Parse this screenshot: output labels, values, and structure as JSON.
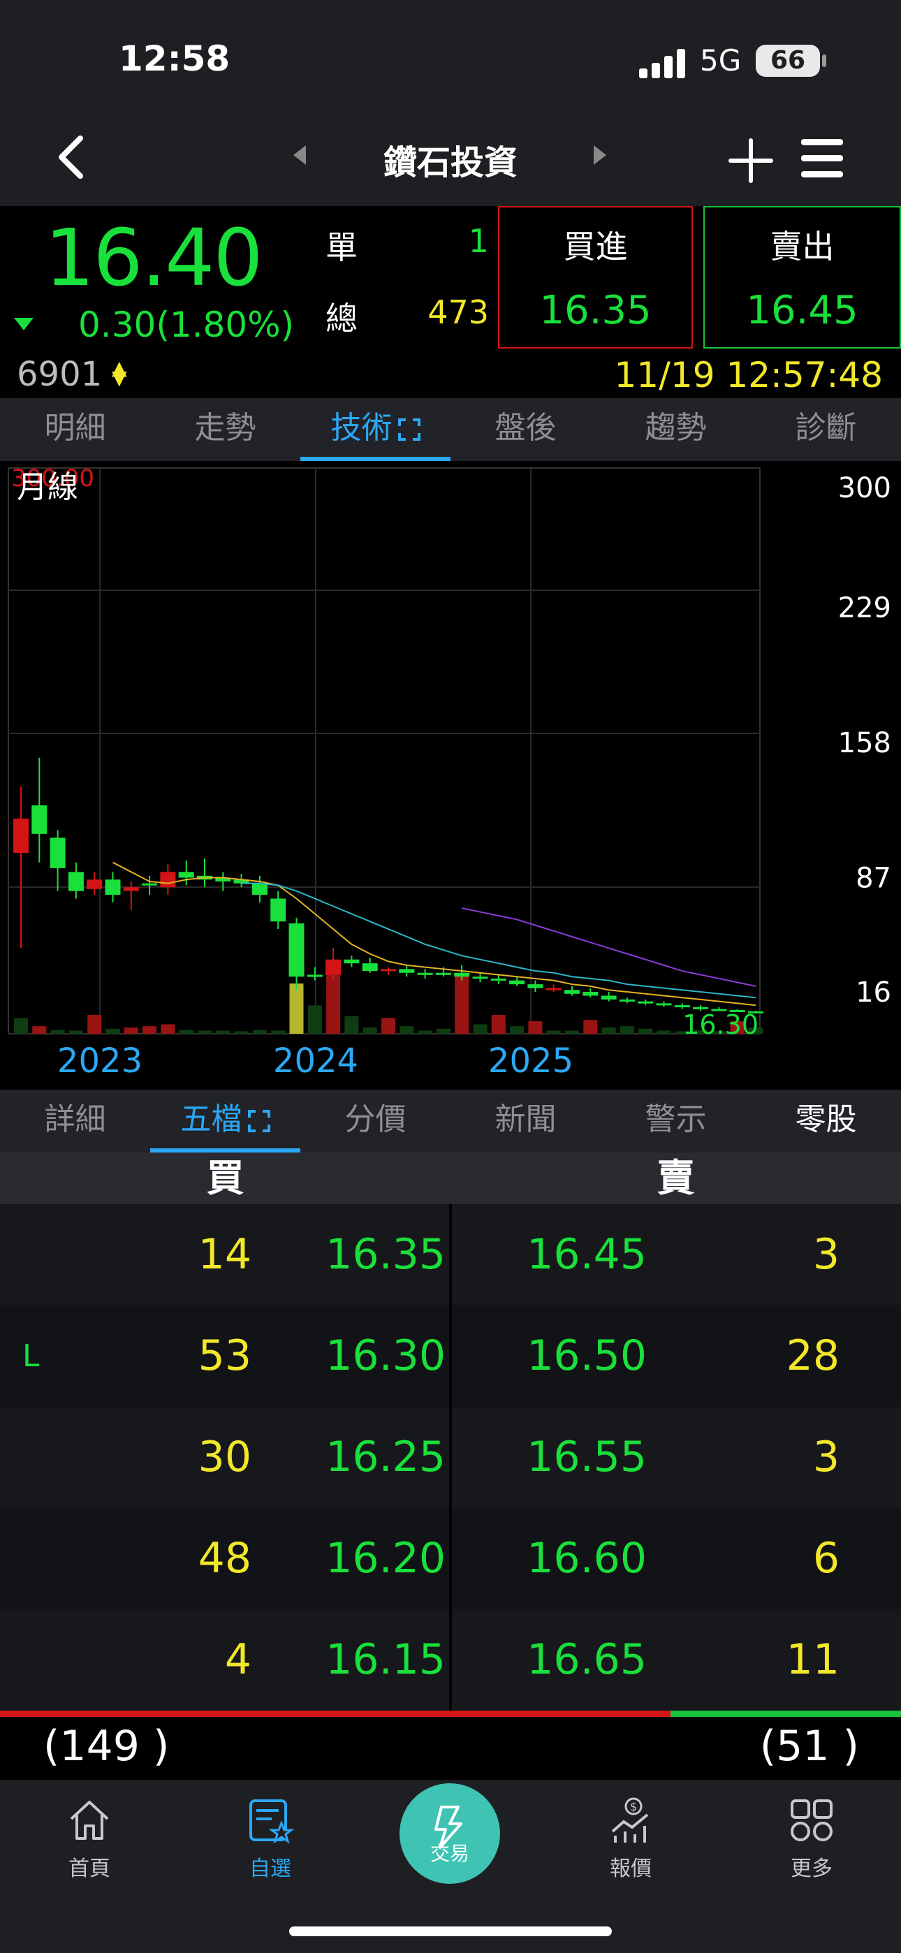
{
  "status": {
    "time": "12:58",
    "network": "5G",
    "battery": "66"
  },
  "nav": {
    "title": "鑽石投資"
  },
  "quote": {
    "price": "16.40",
    "change": "0.30(1.80%)",
    "single_label": "單",
    "single_value": "1",
    "total_label": "總",
    "total_value": "473",
    "buy_label": "買進",
    "buy_value": "16.35",
    "sell_label": "賣出",
    "sell_value": "16.45",
    "code": "6901",
    "datetime": "11/19 12:57:48"
  },
  "tabs_top": [
    {
      "label": "明細"
    },
    {
      "label": "走勢"
    },
    {
      "label": "技術"
    },
    {
      "label": "盤後"
    },
    {
      "label": "趨勢"
    },
    {
      "label": "診斷"
    }
  ],
  "chart": {
    "period_label": "月線",
    "max_label": "300.00",
    "y_ticks": [
      "300",
      "229",
      "158",
      "87",
      "16"
    ],
    "x_ticks": [
      "2023",
      "2024",
      "2025"
    ],
    "last_label": "16.30"
  },
  "chart_data": {
    "type": "candlestick",
    "ylim": [
      16,
      300
    ],
    "y_ticks": [
      300,
      229,
      158,
      87,
      16
    ],
    "x_ticks": [
      "2023",
      "2024",
      "2025"
    ],
    "candles": [
      {
        "o": 100,
        "c": 118,
        "h": 135,
        "l": 50,
        "up": true
      },
      {
        "o": 125,
        "c": 110,
        "h": 150,
        "l": 95,
        "up": false
      },
      {
        "o": 108,
        "c": 92,
        "h": 112,
        "l": 80,
        "up": false
      },
      {
        "o": 90,
        "c": 80,
        "h": 95,
        "l": 76,
        "up": false
      },
      {
        "o": 81,
        "c": 86,
        "h": 90,
        "l": 78,
        "up": true
      },
      {
        "o": 86,
        "c": 78,
        "h": 90,
        "l": 74,
        "up": false
      },
      {
        "o": 80,
        "c": 82,
        "h": 85,
        "l": 70,
        "up": true
      },
      {
        "o": 83,
        "c": 84,
        "h": 88,
        "l": 78,
        "up": false
      },
      {
        "o": 82,
        "c": 90,
        "h": 94,
        "l": 78,
        "up": true
      },
      {
        "o": 90,
        "c": 87,
        "h": 96,
        "l": 83,
        "up": false
      },
      {
        "o": 88,
        "c": 86,
        "h": 97,
        "l": 82,
        "up": false
      },
      {
        "o": 87,
        "c": 85,
        "h": 90,
        "l": 80,
        "up": false
      },
      {
        "o": 86,
        "c": 84,
        "h": 89,
        "l": 82,
        "up": false
      },
      {
        "o": 84,
        "c": 78,
        "h": 88,
        "l": 74,
        "up": false
      },
      {
        "o": 76,
        "c": 64,
        "h": 80,
        "l": 60,
        "up": false
      },
      {
        "o": 63,
        "c": 35,
        "h": 66,
        "l": 28,
        "up": false
      },
      {
        "o": 35,
        "c": 36,
        "h": 40,
        "l": 33,
        "up": false
      },
      {
        "o": 36,
        "c": 44,
        "h": 50,
        "l": 33,
        "up": true
      },
      {
        "o": 44,
        "c": 42,
        "h": 46,
        "l": 40,
        "up": false
      },
      {
        "o": 42,
        "c": 38,
        "h": 45,
        "l": 37,
        "up": false
      },
      {
        "o": 38,
        "c": 39,
        "h": 40,
        "l": 36,
        "up": true
      },
      {
        "o": 39,
        "c": 37,
        "h": 41,
        "l": 35,
        "up": false
      },
      {
        "o": 37,
        "c": 36,
        "h": 39,
        "l": 34,
        "up": false
      },
      {
        "o": 36,
        "c": 37,
        "h": 40,
        "l": 35,
        "up": false
      },
      {
        "o": 37,
        "c": 35,
        "h": 41,
        "l": 33,
        "up": false
      },
      {
        "o": 35,
        "c": 34,
        "h": 37,
        "l": 32,
        "up": false
      },
      {
        "o": 34,
        "c": 33,
        "h": 36,
        "l": 31,
        "up": false
      },
      {
        "o": 33,
        "c": 31,
        "h": 35,
        "l": 30,
        "up": false
      },
      {
        "o": 31,
        "c": 29,
        "h": 33,
        "l": 27,
        "up": false
      },
      {
        "o": 29,
        "c": 28,
        "h": 31,
        "l": 27,
        "up": true
      },
      {
        "o": 28,
        "c": 26,
        "h": 30,
        "l": 25,
        "up": false
      },
      {
        "o": 27,
        "c": 25,
        "h": 29,
        "l": 24,
        "up": false
      },
      {
        "o": 25,
        "c": 23,
        "h": 27,
        "l": 22,
        "up": false
      },
      {
        "o": 23,
        "c": 22,
        "h": 24,
        "l": 21,
        "up": false
      },
      {
        "o": 22,
        "c": 21,
        "h": 23,
        "l": 20,
        "up": false
      },
      {
        "o": 21,
        "c": 20,
        "h": 22,
        "l": 19,
        "up": false
      },
      {
        "o": 20,
        "c": 19,
        "h": 21,
        "l": 18,
        "up": false
      },
      {
        "o": 19,
        "c": 18,
        "h": 20,
        "l": 17,
        "up": false
      },
      {
        "o": 18,
        "c": 17.5,
        "h": 19,
        "l": 17,
        "up": false
      },
      {
        "o": 17.5,
        "c": 16.8,
        "h": 18,
        "l": 16.5,
        "up": false
      },
      {
        "o": 16.8,
        "c": 16.3,
        "h": 17.2,
        "l": 16.2,
        "up": false
      }
    ],
    "volume": [
      0.25,
      0.12,
      0.06,
      0.05,
      0.3,
      0.08,
      0.1,
      0.12,
      0.15,
      0.06,
      0.05,
      0.05,
      0.04,
      0.06,
      0.05,
      0.8,
      0.45,
      1.0,
      0.28,
      0.1,
      0.25,
      0.12,
      0.05,
      0.08,
      0.93,
      0.15,
      0.3,
      0.12,
      0.2,
      0.05,
      0.05,
      0.22,
      0.1,
      0.12,
      0.08,
      0.05,
      0.04,
      0.06,
      0.04,
      0.2,
      0.1
    ],
    "volume_up": [
      false,
      true,
      false,
      false,
      true,
      false,
      true,
      true,
      true,
      false,
      false,
      false,
      false,
      false,
      false,
      false,
      false,
      true,
      false,
      false,
      true,
      false,
      false,
      false,
      true,
      false,
      true,
      false,
      true,
      false,
      false,
      true,
      false,
      false,
      false,
      false,
      false,
      false,
      false,
      true,
      false
    ],
    "volume_yellow_index": 15,
    "ma_fast": [
      null,
      null,
      null,
      null,
      null,
      95,
      90,
      85,
      84,
      86,
      87,
      87,
      86,
      85,
      83,
      76,
      68,
      60,
      52,
      47,
      43,
      41,
      40,
      39,
      38,
      37,
      36,
      35,
      34,
      33,
      31,
      30,
      28,
      27,
      26,
      25,
      24,
      23,
      22,
      21,
      20
    ],
    "ma_mid": [
      null,
      null,
      null,
      null,
      null,
      null,
      null,
      null,
      null,
      null,
      null,
      null,
      84,
      84,
      83,
      80,
      76,
      72,
      68,
      64,
      60,
      56,
      52,
      49,
      46,
      44,
      42,
      40,
      38,
      37,
      35,
      34,
      33,
      31,
      30,
      29,
      28,
      27,
      26,
      25,
      24
    ],
    "ma_slow": [
      null,
      null,
      null,
      null,
      null,
      null,
      null,
      null,
      null,
      null,
      null,
      null,
      null,
      null,
      null,
      null,
      null,
      null,
      null,
      null,
      null,
      null,
      null,
      null,
      71,
      69,
      67,
      65,
      62,
      59,
      56,
      53,
      50,
      47,
      44,
      41,
      38,
      36,
      34,
      32,
      30
    ]
  },
  "tabs_bottom": [
    {
      "label": "詳細"
    },
    {
      "label": "五檔"
    },
    {
      "label": "分價"
    },
    {
      "label": "新聞"
    },
    {
      "label": "警示"
    },
    {
      "label": "零股"
    }
  ],
  "orderbook": {
    "buy_header": "買",
    "sell_header": "賣",
    "rows": [
      {
        "flag": "",
        "bq": "14",
        "bp": "16.35",
        "sp": "16.45",
        "sq": "3"
      },
      {
        "flag": "L",
        "bq": "53",
        "bp": "16.30",
        "sp": "16.50",
        "sq": "28"
      },
      {
        "flag": "",
        "bq": "30",
        "bp": "16.25",
        "sp": "16.55",
        "sq": "3"
      },
      {
        "flag": "",
        "bq": "48",
        "bp": "16.20",
        "sp": "16.60",
        "sq": "6"
      },
      {
        "flag": "",
        "bq": "4",
        "bp": "16.15",
        "sp": "16.65",
        "sq": "11"
      }
    ],
    "buy_total": "(149 )",
    "sell_total": "(51 )",
    "buy_ratio": 0.744
  },
  "bottom_nav": [
    {
      "label": "首頁",
      "icon": "home-icon"
    },
    {
      "label": "自選",
      "icon": "watchlist-icon"
    },
    {
      "label": "交易",
      "icon": "trade-icon"
    },
    {
      "label": "報價",
      "icon": "quote-icon"
    },
    {
      "label": "更多",
      "icon": "more-icon"
    }
  ],
  "colors": {
    "up": "#d31515",
    "down": "#19e03a",
    "accent": "#2ba8f5",
    "value": "#f2e82a",
    "trade": "#3fc4b4"
  }
}
